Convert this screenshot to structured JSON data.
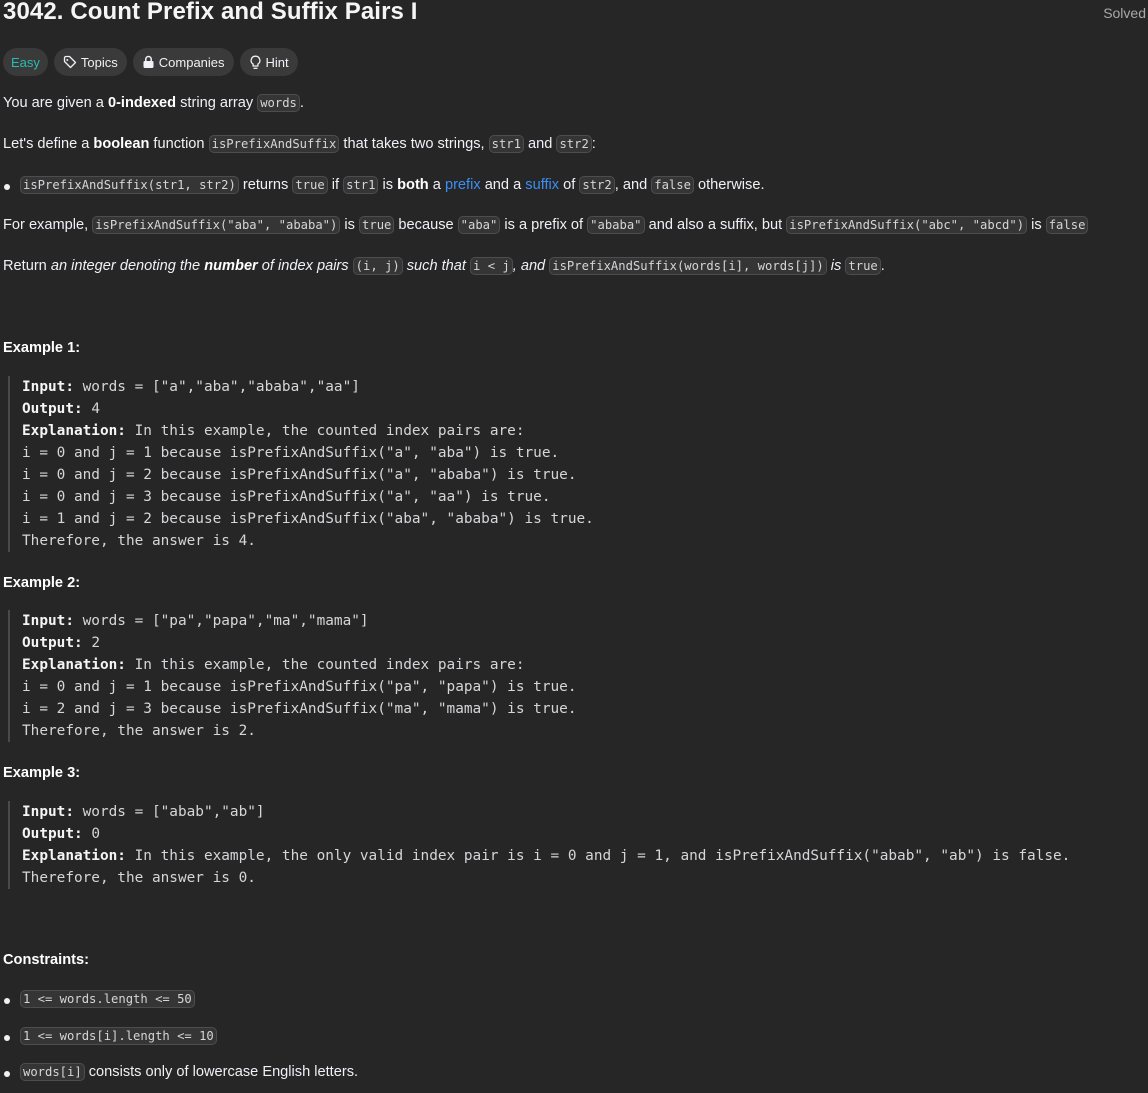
{
  "problem": {
    "title": "3042. Count Prefix and Suffix Pairs I",
    "status": "Solved"
  },
  "tags": {
    "difficulty": "Easy",
    "topics": "Topics",
    "companies": "Companies",
    "hint": "Hint"
  },
  "desc": {
    "l1_a": "You are given a ",
    "l1_b": "0-indexed",
    "l1_c": " string array ",
    "l1_code": "words",
    "l1_d": ".",
    "l2_a": "Let's define a ",
    "l2_b": "boolean",
    "l2_c": " function ",
    "l2_code1": "isPrefixAndSuffix",
    "l2_d": " that takes two strings, ",
    "l2_code2": "str1",
    "l2_e": " and ",
    "l2_code3": "str2",
    "l2_f": ":",
    "b1_code1": "isPrefixAndSuffix(str1, str2)",
    "b1_a": " returns ",
    "b1_code2": "true",
    "b1_b": " if ",
    "b1_code3": "str1",
    "b1_c": " is ",
    "b1_d": "both",
    "b1_e": " a ",
    "b1_prefix": "prefix",
    "b1_f": " and a ",
    "b1_suffix": "suffix",
    "b1_g": " of ",
    "b1_code4": "str2",
    "b1_h": ", and ",
    "b1_code5": "false",
    "b1_i": " otherwise.",
    "l3_a": "For example, ",
    "l3_code1": "isPrefixAndSuffix(\"aba\", \"ababa\")",
    "l3_b": " is ",
    "l3_code2": "true",
    "l3_c": " because ",
    "l3_code3": "\"aba\"",
    "l3_d": " is a prefix of ",
    "l3_code4": "\"ababa\"",
    "l3_e": " and also a suffix, but ",
    "l3_code5": "isPrefixAndSuffix(\"abc\", \"abcd\")",
    "l3_f": " is ",
    "l3_code6": "false",
    "l4_a": "Return ",
    "l4_b": "an integer denoting the ",
    "l4_c": "number",
    "l4_d": " of index pairs ",
    "l4_code1": "(i, j)",
    "l4_e": " such that ",
    "l4_code2": "i < j",
    "l4_f": ", and ",
    "l4_code3": "isPrefixAndSuffix(words[i], words[j])",
    "l4_g": " is ",
    "l4_code4": "true",
    "l4_h": "."
  },
  "examples": [
    {
      "heading": "Example 1:",
      "input_label": "Input:",
      "input": " words = [\"a\",\"aba\",\"ababa\",\"aa\"]",
      "output_label": "Output:",
      "output": " 4",
      "explanation_label": "Explanation:",
      "explanation": " In this example, the counted index pairs are:",
      "lines": [
        "i = 0 and j = 1 because isPrefixAndSuffix(\"a\", \"aba\") is true.",
        "i = 0 and j = 2 because isPrefixAndSuffix(\"a\", \"ababa\") is true.",
        "i = 0 and j = 3 because isPrefixAndSuffix(\"a\", \"aa\") is true.",
        "i = 1 and j = 2 because isPrefixAndSuffix(\"aba\", \"ababa\") is true.",
        "Therefore, the answer is 4."
      ]
    },
    {
      "heading": "Example 2:",
      "input_label": "Input:",
      "input": " words = [\"pa\",\"papa\",\"ma\",\"mama\"]",
      "output_label": "Output:",
      "output": " 2",
      "explanation_label": "Explanation:",
      "explanation": " In this example, the counted index pairs are:",
      "lines": [
        "i = 0 and j = 1 because isPrefixAndSuffix(\"pa\", \"papa\") is true.",
        "i = 2 and j = 3 because isPrefixAndSuffix(\"ma\", \"mama\") is true.",
        "Therefore, the answer is 2."
      ]
    },
    {
      "heading": "Example 3:",
      "input_label": "Input:",
      "input": " words = [\"abab\",\"ab\"]",
      "output_label": "Output:",
      "output": " 0",
      "explanation_label": "Explanation:",
      "explanation": " In this example, the only valid index pair is i = 0 and j = 1, and isPrefixAndSuffix(\"abab\", \"ab\") is false.",
      "lines": [
        "Therefore, the answer is 0."
      ]
    }
  ],
  "constraints": {
    "heading": "Constraints:",
    "c1": "1 <= words.length <= 50",
    "c2": "1 <= words[i].length <= 10",
    "c3_code": "words[i]",
    "c3_text": " consists only of lowercase English letters."
  },
  "colors": {
    "background": "#262626",
    "easy": "#2cbbb0",
    "link": "#3b8ff3"
  }
}
